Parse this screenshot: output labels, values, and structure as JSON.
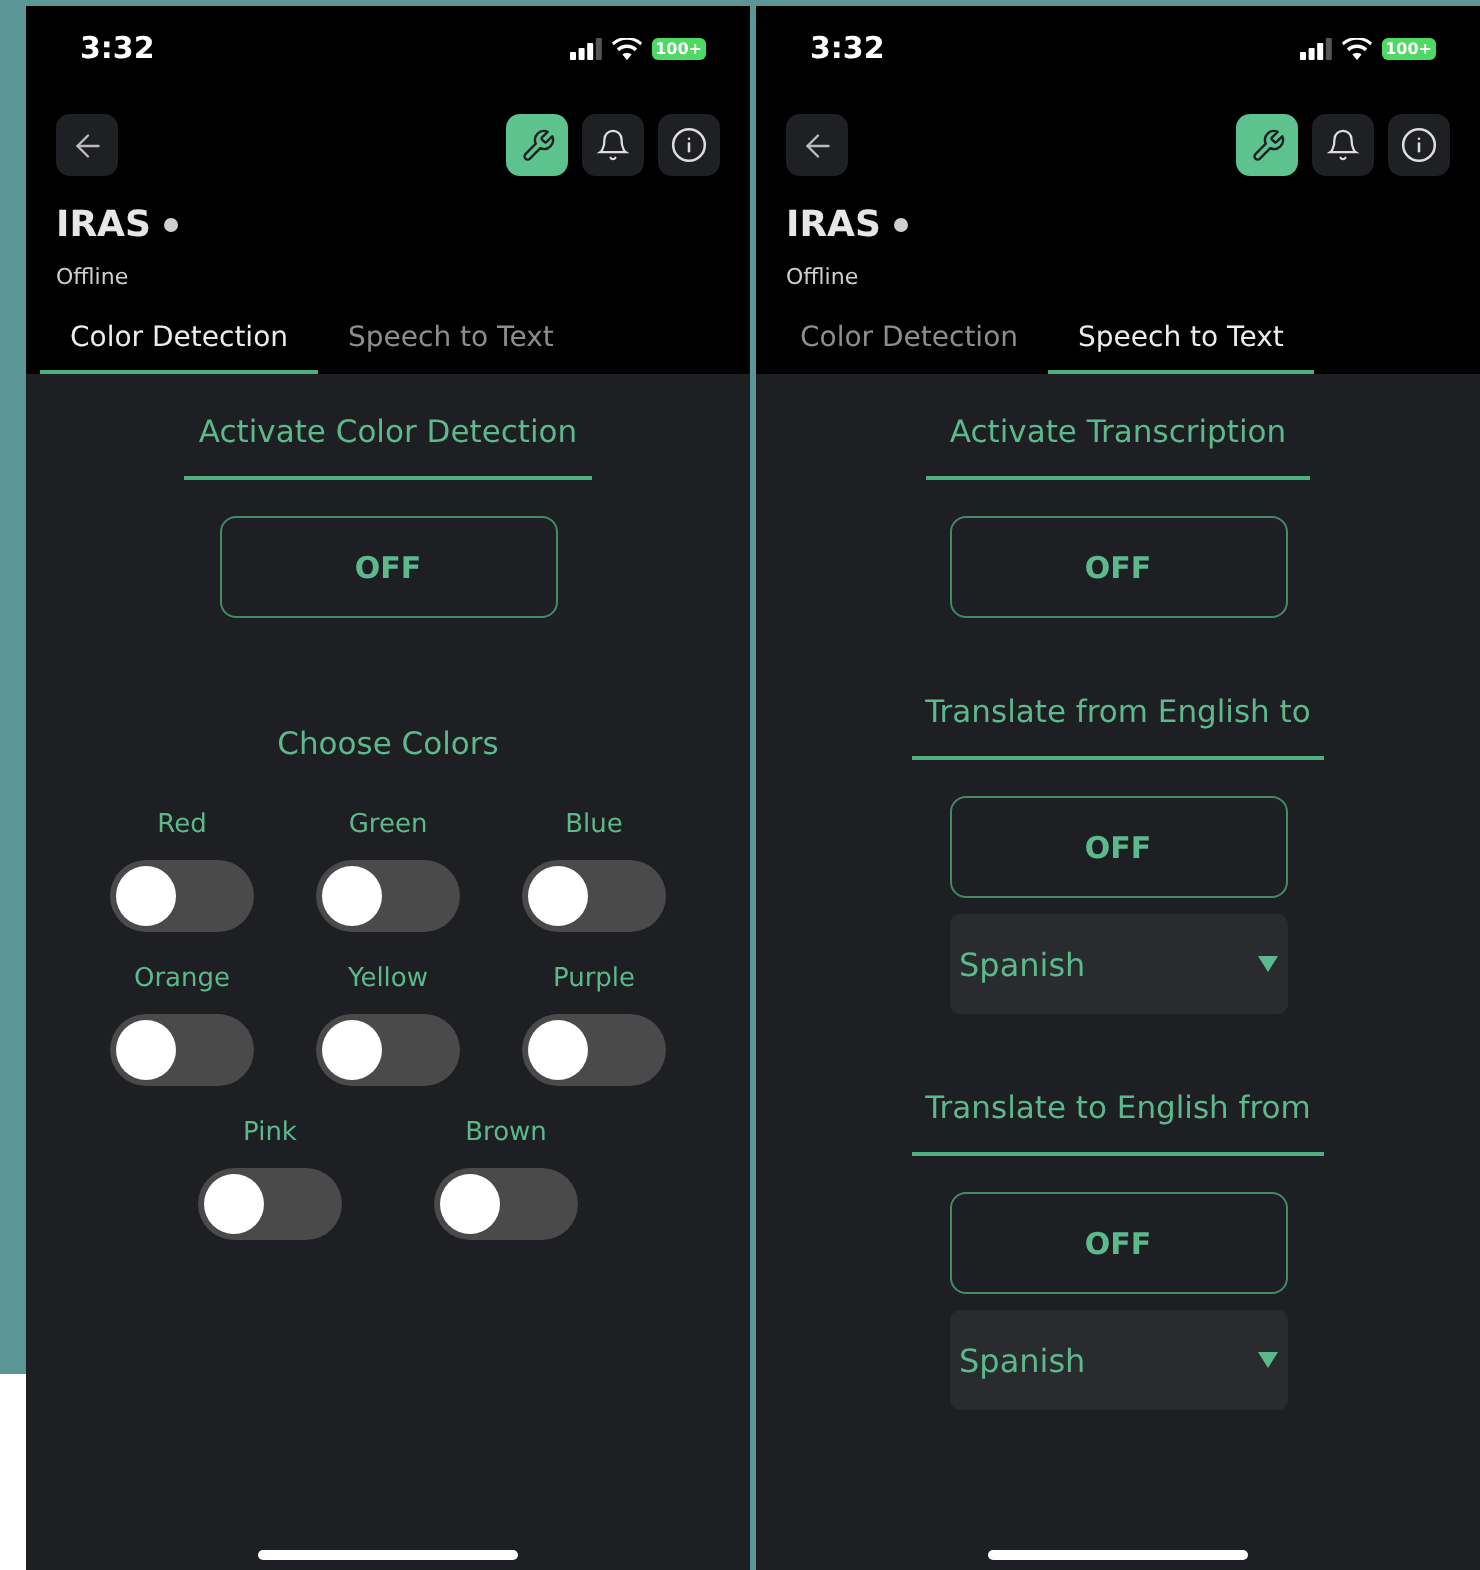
{
  "screens": [
    {
      "status_bar": {
        "time": "3:32",
        "battery": "100+"
      },
      "tool_buttons": [
        {
          "selected": true
        },
        {
          "selected": false
        },
        {
          "selected": false
        }
      ],
      "device": {
        "name": "IRAS",
        "status": "Offline"
      },
      "tabs": [
        {
          "label": "Color Detection",
          "selected": true
        },
        {
          "label": "Speech to Text",
          "selected": false
        }
      ],
      "sections": [
        {
          "kind": "heading",
          "text": "Activate Color Detection",
          "rule": true
        },
        {
          "kind": "button",
          "label": "OFF"
        },
        {
          "kind": "heading",
          "text": "Choose Colors",
          "rule": false
        },
        {
          "kind": "toggles",
          "rows": [
            {
              "items": [
                {
                  "label": "Red",
                  "on": false
                },
                {
                  "label": "Green",
                  "on": false
                },
                {
                  "label": "Blue",
                  "on": false
                }
              ]
            },
            {
              "items": [
                {
                  "label": "Orange",
                  "on": false
                },
                {
                  "label": "Yellow",
                  "on": false
                },
                {
                  "label": "Purple",
                  "on": false
                }
              ]
            },
            {
              "items": [
                {
                  "label": "Pink",
                  "on": false
                },
                {
                  "label": "Brown",
                  "on": false
                }
              ]
            }
          ]
        }
      ]
    },
    {
      "status_bar": {
        "time": "3:32",
        "battery": "100+"
      },
      "tool_buttons": [
        {
          "selected": true
        },
        {
          "selected": false
        },
        {
          "selected": false
        }
      ],
      "device": {
        "name": "IRAS",
        "status": "Offline"
      },
      "tabs": [
        {
          "label": "Color Detection",
          "selected": false
        },
        {
          "label": "Speech to Text",
          "selected": true
        }
      ],
      "sections": [
        {
          "kind": "heading",
          "text": "Activate Transcription",
          "rule": true
        },
        {
          "kind": "button",
          "label": "OFF"
        },
        {
          "kind": "heading",
          "text": "Translate from English to",
          "rule": true
        },
        {
          "kind": "button",
          "label": "OFF"
        },
        {
          "kind": "dropdown",
          "value": "Spanish"
        },
        {
          "kind": "heading",
          "text": "Translate to English from",
          "rule": true
        },
        {
          "kind": "button",
          "label": "OFF"
        },
        {
          "kind": "dropdown",
          "value": "Spanish"
        }
      ]
    }
  ]
}
